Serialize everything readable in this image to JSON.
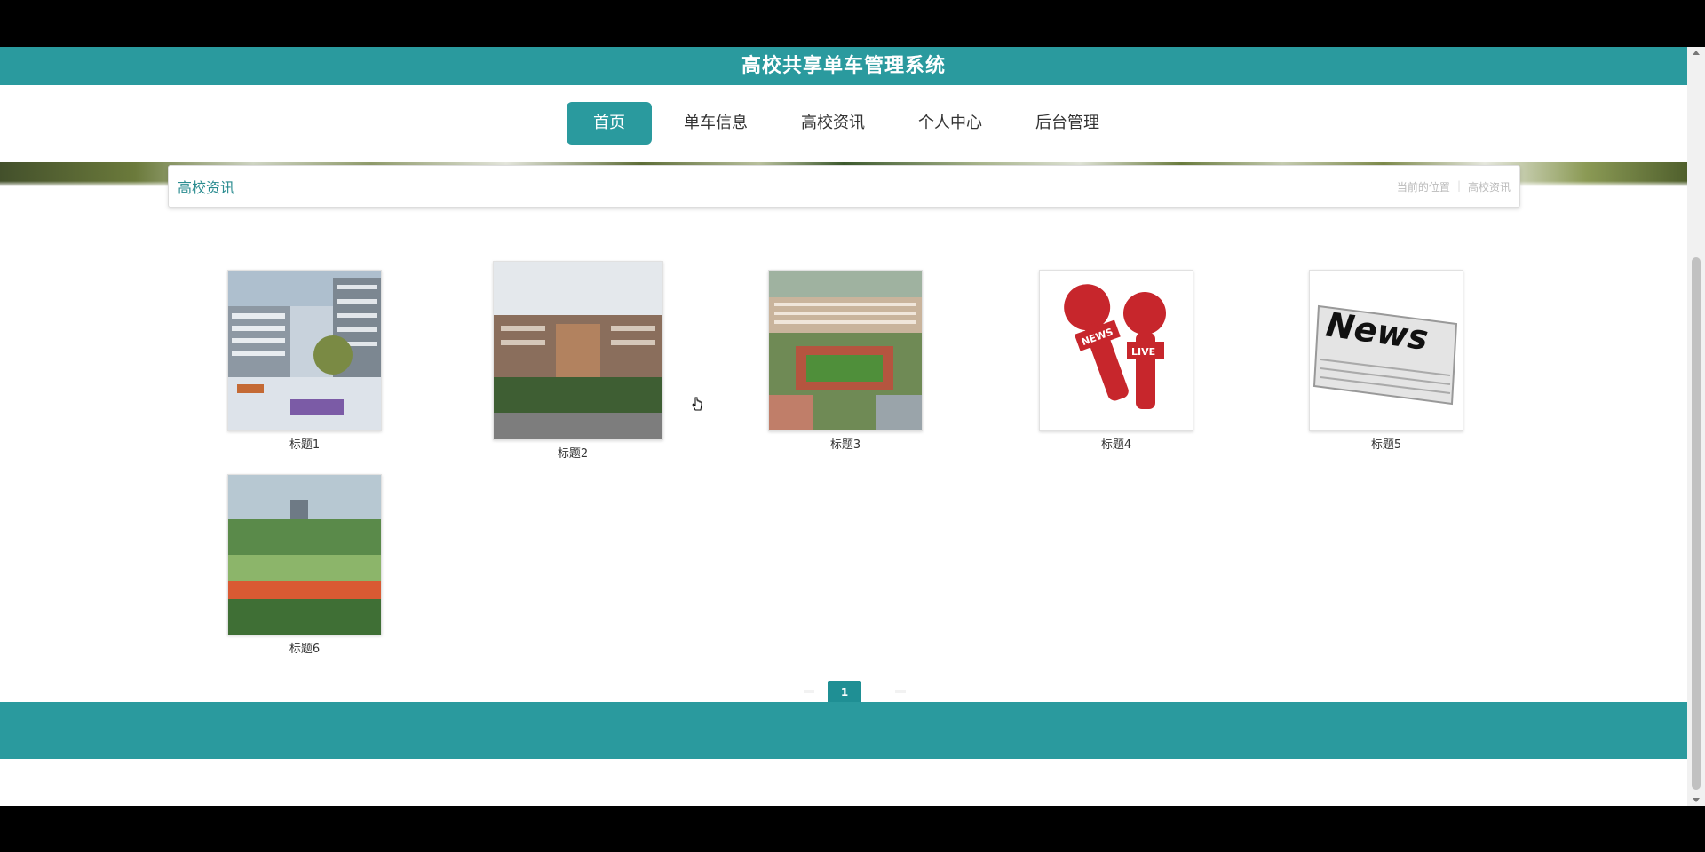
{
  "header": {
    "title": "高校共享单车管理系统"
  },
  "nav": {
    "items": [
      {
        "label": "首页",
        "active": true
      },
      {
        "label": "单车信息",
        "active": false
      },
      {
        "label": "高校资讯",
        "active": false
      },
      {
        "label": "个人中心",
        "active": false
      },
      {
        "label": "后台管理",
        "active": false
      }
    ]
  },
  "section": {
    "title": "高校资讯",
    "breadcrumb": [
      "当前的位置",
      "高校资讯"
    ]
  },
  "cards": [
    {
      "title": "标题1",
      "image": "campus-building-photo"
    },
    {
      "title": "标题2",
      "image": "campus-gate-photo"
    },
    {
      "title": "标题3",
      "image": "campus-aerial-photo"
    },
    {
      "title": "标题4",
      "image": "news-microphone-icon",
      "badge1": "NEWS",
      "badge2": "LIVE"
    },
    {
      "title": "标题5",
      "image": "newspaper-icon",
      "word": "News"
    },
    {
      "title": "标题6",
      "image": "sports-field-photo"
    }
  ],
  "pagination": {
    "current": "1"
  },
  "colors": {
    "primary": "#2a9a9e",
    "active_page": "#1f8f94"
  }
}
